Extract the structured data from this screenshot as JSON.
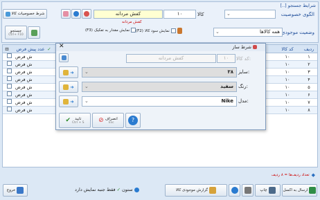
{
  "search_section": {
    "title": "[..] شرایط جستجو"
  },
  "filters": {
    "pattern_label": "الگوی خصوصیت",
    "code_label": "کالا",
    "code_value": "۱۰",
    "name_value": "کفش مردانه",
    "subtitle": "کفش مردانه",
    "stock_status_label": "وضعیت موجودی",
    "stock_status_value": "همه کالاها",
    "show_profit_label": "نمایش سود کالا",
    "show_profit_key": "(F2)",
    "separate_qty_label": "نمایش مقدار به تفکیک",
    "separate_qty_key": "(F3)",
    "search_btn": "جستجو",
    "search_btn_key": "Ctrl+ F10",
    "pattern_cond_btn": "شرط خصوصیات کالا"
  },
  "table": {
    "headers": [
      "ردیف",
      "کد کالا",
      "عدد پیش فرض"
    ],
    "rows": [
      {
        "row": "۱",
        "code": "۱۰",
        "default": "ش فرض"
      },
      {
        "row": "۲",
        "code": "۱۰",
        "default": "ش فرض"
      },
      {
        "row": "۳",
        "code": "۱۰",
        "default": "ش فرض"
      },
      {
        "row": "۴",
        "code": "۱۰",
        "default": "ش فرض"
      },
      {
        "row": "۵",
        "code": "۱۰",
        "default": "ش فرض"
      },
      {
        "row": "۶",
        "code": "۱۰",
        "default": "ش فرض"
      },
      {
        "row": "۷",
        "code": "۱۰",
        "default": "ش فرض"
      },
      {
        "row": "۸",
        "code": "۱۰",
        "default": "ش فرض"
      }
    ]
  },
  "dialog": {
    "title": "شرط ساز",
    "code_label": "کد کالا:",
    "code_value": "۱۰",
    "name_value": "کفش مردانه",
    "conditions": [
      {
        "label": "سایز:",
        "value": "۳۸"
      },
      {
        "label": "رنگ:",
        "value": "سفید"
      },
      {
        "label": "مدل:",
        "value": "Nike"
      }
    ],
    "confirm_btn": "تایید",
    "confirm_key": "Ctrl + S",
    "cancel_btn": "انصراف",
    "cancel_key": "Esc"
  },
  "summary": {
    "row_count": "تعداد ردیف‌ها = ۸ ردیف"
  },
  "toolbar": {
    "send_excel": "ارسال به اکسل",
    "print": "چاپ",
    "stock_report": "گزارش موجودی کالا",
    "columns": "ستون",
    "only_view": "فقط جنبه نمایش دارد",
    "exit": "خروج"
  }
}
